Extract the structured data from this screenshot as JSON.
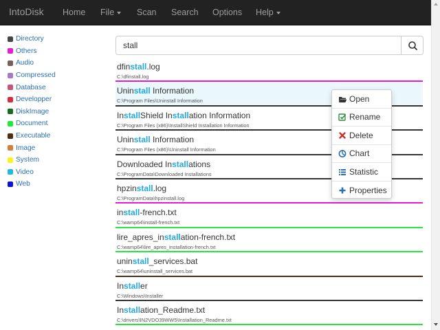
{
  "navbar": {
    "brand": "IntoDisk",
    "items": [
      {
        "label": "Home",
        "has_caret": false
      },
      {
        "label": "File",
        "has_caret": true
      },
      {
        "label": "Scan",
        "has_caret": false
      },
      {
        "label": "Search",
        "has_caret": false
      },
      {
        "label": "Options",
        "has_caret": false
      },
      {
        "label": "Help",
        "has_caret": true
      }
    ]
  },
  "sidebar": {
    "types": [
      {
        "label": "Directory",
        "color": "#454545"
      },
      {
        "label": "Others",
        "color": "#e81ad8"
      },
      {
        "label": "Audio",
        "color": "#755f5f"
      },
      {
        "label": "Compressed",
        "color": "#a37ac8"
      },
      {
        "label": "Database",
        "color": "#c5557b"
      },
      {
        "label": "Developper",
        "color": "#db2a3c"
      },
      {
        "label": "DiskImage",
        "color": "#166d1f"
      },
      {
        "label": "Document",
        "color": "#22e93d"
      },
      {
        "label": "Executable",
        "color": "#4e2e12"
      },
      {
        "label": "Image",
        "color": "#d47f3c"
      },
      {
        "label": "System",
        "color": "#fcf21c"
      },
      {
        "label": "Video",
        "color": "#23b8e3"
      },
      {
        "label": "Web",
        "color": "#0f12d3"
      }
    ]
  },
  "search": {
    "value": "stall",
    "button_icon": "search-icon"
  },
  "results": [
    {
      "parts": [
        "dfin",
        "stall",
        ".log"
      ],
      "path": "C:\\dfinstall.log",
      "color": "#e81ad8"
    },
    {
      "parts": [
        "Unin",
        "stall",
        " Information"
      ],
      "path": "C:\\Program Files\\Uninstall Information",
      "color": "#333333",
      "highlighted": true
    },
    {
      "parts": [
        "In",
        "stall",
        "Shield In",
        "stall",
        "ation Information"
      ],
      "path": "C:\\Program Files (x86)\\InstallShield Installation Information",
      "color": "#333333"
    },
    {
      "parts": [
        "Unin",
        "stall",
        " Information"
      ],
      "path": "C:\\Program Files (x86)\\Uninstall Information",
      "color": "#333333"
    },
    {
      "parts": [
        "Downloaded In",
        "stall",
        "ations"
      ],
      "path": "C:\\ProgramData\\Downloaded Installations",
      "color": "#333333"
    },
    {
      "parts": [
        "hpzin",
        "stall",
        ".log"
      ],
      "path": "C:\\ProgramData\\hpzinstall.log",
      "color": "#e81ad8"
    },
    {
      "parts": [
        "in",
        "stall",
        "-french.txt"
      ],
      "path": "C:\\wamp64\\install-french.txt",
      "color": "#22e93d"
    },
    {
      "parts": [
        "lire_apres_in",
        "stall",
        "ation-french.txt"
      ],
      "path": "C:\\wamp64\\lire_apres_installation-french.txt",
      "color": "#22e93d"
    },
    {
      "parts": [
        "unin",
        "stall",
        "_services.bat"
      ],
      "path": "C:\\wamp64\\uninstall_services.bat",
      "color": "#4e2e12"
    },
    {
      "parts": [
        "In",
        "stall",
        "er"
      ],
      "path": "C:\\Windows\\Installer",
      "color": "#333333"
    },
    {
      "parts": [
        "In",
        "stall",
        "ation_Readme.txt"
      ],
      "path": "C:\\drivers\\IN2VDO39WW5\\Installation_Readme.txt",
      "color": "#22e93d"
    }
  ],
  "context_menu": {
    "items": [
      {
        "label": "Open",
        "icon": "folder-open-icon",
        "icon_color": "#333333"
      },
      {
        "label": "Rename",
        "icon": "edit-icon",
        "icon_color": "#2e8b3d"
      },
      {
        "label": "Delete",
        "icon": "close-icon",
        "icon_color": "#c9302c"
      },
      {
        "label": "Chart",
        "icon": "pie-chart-icon",
        "icon_color": "#2a6fb3"
      },
      {
        "label": "Statistic",
        "icon": "list-icon",
        "icon_color": "#2a6fb3"
      },
      {
        "label": "Properties",
        "icon": "plus-icon",
        "icon_color": "#2a6fb3"
      }
    ]
  }
}
